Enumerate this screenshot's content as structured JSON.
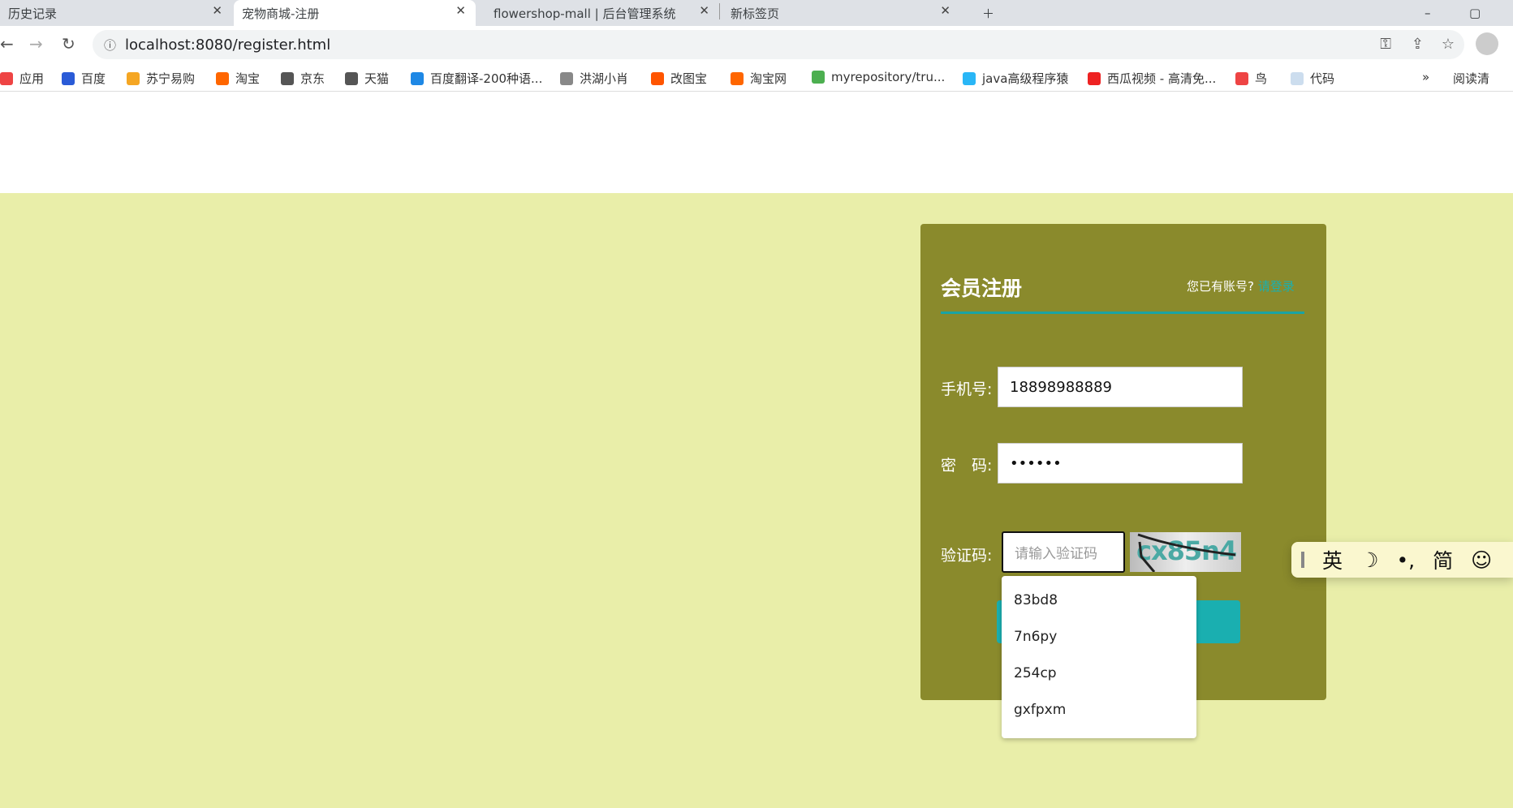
{
  "browser": {
    "tabs": [
      {
        "label": "历史记录",
        "active": false
      },
      {
        "label": "宠物商城-注册",
        "active": true
      },
      {
        "label": "flowershop-mall | 后台管理系统",
        "active": false
      },
      {
        "label": "新标签页",
        "active": false
      }
    ],
    "url": "localhost:8080/register.html",
    "bookmarks": [
      "应用",
      "百度",
      "苏宁易购",
      "淘宝",
      "京东",
      "天猫",
      "百度翻译-200种语...",
      "洪湖小肖",
      "改图宝",
      "淘宝网",
      "myrepository/tru...",
      "java高级程序猿",
      "西瓜视频 - 高清免...",
      "鸟",
      "代码"
    ],
    "reading_list": "阅读清"
  },
  "form": {
    "title": "会员注册",
    "have_account": "您已有账号?",
    "login_link": "请登录",
    "phone_label": "手机号:",
    "phone_value": "18898988889",
    "password_label": "密　码:",
    "password_value": "••••••",
    "captcha_label": "验证码:",
    "captcha_placeholder": "请输入验证码",
    "captcha_image_text": "cx85n4",
    "accent": "#1aa3a3"
  },
  "autocomplete": [
    "83bd8",
    "7n6py",
    "254cp",
    "gxfpxm"
  ],
  "ime": {
    "items": [
      "英",
      "☽",
      "•,",
      "简",
      "☺"
    ]
  }
}
